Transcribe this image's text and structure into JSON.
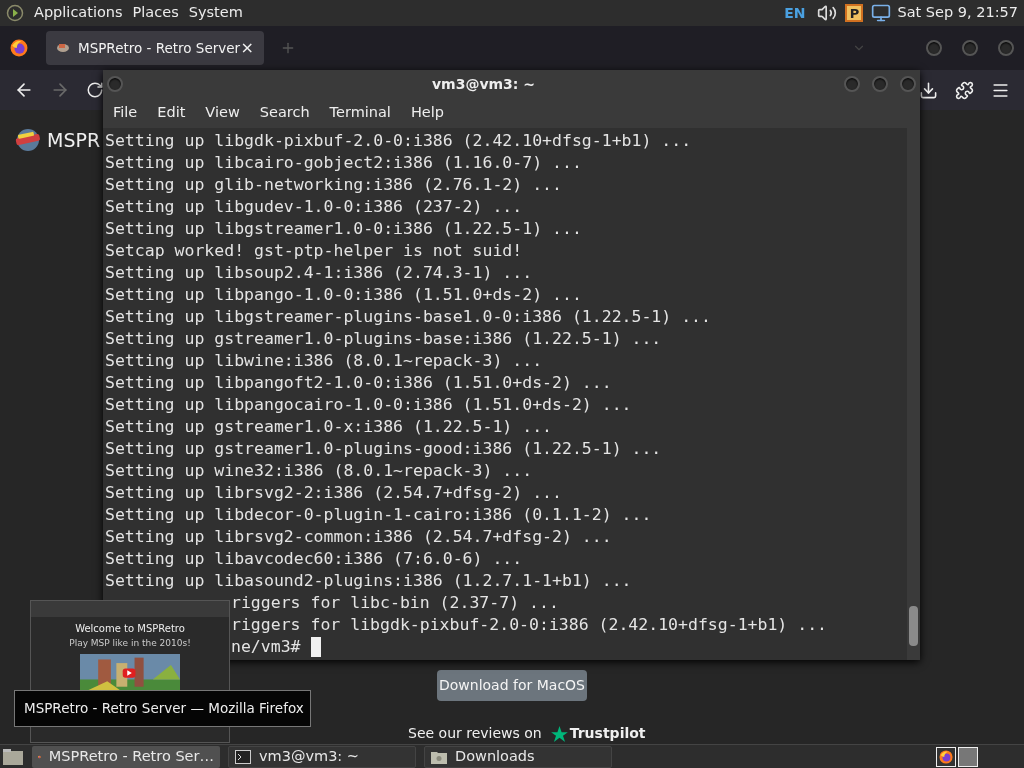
{
  "top_panel": {
    "menus": [
      "Applications",
      "Places",
      "System"
    ],
    "keyboard_layout": "EN",
    "tray_badge": "P",
    "clock": "Sat Sep 9, 21:57"
  },
  "browser": {
    "tabs": [
      {
        "title": "MSPRetro - Retro Server",
        "close": "×",
        "selected": true
      }
    ],
    "forward_disabled": true
  },
  "page": {
    "logo_text": "MSPR",
    "download_button": "Download for MacOS",
    "reviews_text": "See our reviews on",
    "reviews_brand": "Trustpilot"
  },
  "terminal": {
    "title": "vm3@vm3: ~",
    "menu": [
      "File",
      "Edit",
      "View",
      "Search",
      "Terminal",
      "Help"
    ],
    "lines": [
      {
        "kind": "full",
        "text": "Setting up libgdk-pixbuf-2.0-0:i386 (2.42.10+dfsg-1+b1) ..."
      },
      {
        "kind": "full",
        "text": "Setting up libcairo-gobject2:i386 (1.16.0-7) ..."
      },
      {
        "kind": "full",
        "text": "Setting up glib-networking:i386 (2.76.1-2) ..."
      },
      {
        "kind": "full",
        "text": "Setting up libgudev-1.0-0:i386 (237-2) ..."
      },
      {
        "kind": "full",
        "text": "Setting up libgstreamer1.0-0:i386 (1.22.5-1) ..."
      },
      {
        "kind": "full",
        "text": "Setcap worked! gst-ptp-helper is not suid!"
      },
      {
        "kind": "full",
        "text": "Setting up libsoup2.4-1:i386 (2.74.3-1) ..."
      },
      {
        "kind": "full",
        "text": "Setting up libpango-1.0-0:i386 (1.51.0+ds-2) ..."
      },
      {
        "kind": "full",
        "text": "Setting up libgstreamer-plugins-base1.0-0:i386 (1.22.5-1) ..."
      },
      {
        "kind": "full",
        "text": "Setting up gstreamer1.0-plugins-base:i386 (1.22.5-1) ..."
      },
      {
        "kind": "full",
        "text": "Setting up libwine:i386 (8.0.1~repack-3) ..."
      },
      {
        "kind": "full",
        "text": "Setting up libpangoft2-1.0-0:i386 (1.51.0+ds-2) ..."
      },
      {
        "kind": "full",
        "text": "Setting up libpangocairo-1.0-0:i386 (1.51.0+ds-2) ..."
      },
      {
        "kind": "full",
        "text": "Setting up gstreamer1.0-x:i386 (1.22.5-1) ..."
      },
      {
        "kind": "full",
        "text": "Setting up gstreamer1.0-plugins-good:i386 (1.22.5-1) ..."
      },
      {
        "kind": "full",
        "text": "Setting up wine32:i386 (8.0.1~repack-3) ..."
      },
      {
        "kind": "full",
        "text": "Setting up librsvg2-2:i386 (2.54.7+dfsg-2) ..."
      },
      {
        "kind": "full",
        "text": "Setting up libdecor-0-plugin-1-cairo:i386 (0.1.1-2) ..."
      },
      {
        "kind": "full",
        "text": "Setting up librsvg2-common:i386 (2.54.7+dfsg-2) ..."
      },
      {
        "kind": "full",
        "text": "Setting up libavcodec60:i386 (7:6.0-6) ..."
      },
      {
        "kind": "full",
        "text": "Setting up libasound2-plugins:i386 (1.2.7.1-1+b1) ..."
      },
      {
        "kind": "partial",
        "text": "riggers for libc-bin (2.37-7) ..."
      },
      {
        "kind": "partial",
        "text": "riggers for libgdk-pixbuf-2.0-0:i386 (2.42.10+dfsg-1+b1) ..."
      },
      {
        "kind": "prompt",
        "text": "ne/vm3#"
      }
    ]
  },
  "preview": {
    "heading": "Welcome to MSPRetro",
    "subheading": "Play MSP like in the 2010s!",
    "tooltip": "MSPRetro - Retro Server — Mozilla Firefox"
  },
  "taskbar": {
    "items": [
      {
        "kind": "browser",
        "label": "MSPRetro - Retro Ser…",
        "selected": true
      },
      {
        "kind": "terminal",
        "label": "vm3@vm3: ~",
        "selected": false
      },
      {
        "kind": "folder",
        "label": "Downloads",
        "selected": false
      }
    ]
  }
}
